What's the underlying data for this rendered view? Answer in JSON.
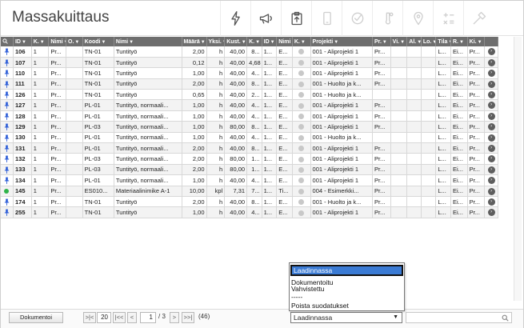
{
  "header": {
    "title": "Massakuittaus",
    "toolbar": [
      {
        "name": "bolt-icon",
        "enabled": true
      },
      {
        "name": "megaphone-icon",
        "enabled": true
      },
      {
        "name": "clipboard-upload-icon",
        "enabled": true
      },
      {
        "name": "phone-icon",
        "enabled": false
      },
      {
        "name": "check-circle-icon",
        "enabled": false
      },
      {
        "name": "thermometer-icon",
        "enabled": false
      },
      {
        "name": "location-pin-icon",
        "enabled": false
      },
      {
        "name": "calculator-icon",
        "enabled": false
      },
      {
        "name": "hammer-icon",
        "enabled": false
      }
    ]
  },
  "table": {
    "columns": [
      "ID",
      "K.",
      "Nimi",
      "O.",
      "Koodi",
      "Nimi",
      "Määrä",
      "Yksi.",
      "Kust.",
      "K.",
      "ID",
      "Nimi",
      "K.",
      "Projekti",
      "Pr.",
      "Vi.",
      "Al.",
      "Lo.",
      "Tila",
      "R.",
      "Ki."
    ],
    "rows": [
      {
        "status": "pin",
        "cells": [
          "106",
          "1",
          "Pr...",
          "",
          "TN-01",
          "Tuntityö",
          "2,00",
          "h",
          "40,00",
          "8...",
          "1...",
          "E...",
          "",
          "001 - Aliprojekti 1",
          "Pr...",
          "",
          "",
          "",
          "L...",
          "Ei...",
          "Pr..."
        ]
      },
      {
        "status": "pin",
        "cells": [
          "107",
          "1",
          "Pr...",
          "",
          "TN-01",
          "Tuntityö",
          "0,12",
          "h",
          "40,00",
          "4,68",
          "1...",
          "E...",
          "",
          "001 - Aliprojekti 1",
          "Pr...",
          "",
          "",
          "",
          "L...",
          "Ei...",
          "Pr..."
        ]
      },
      {
        "status": "pin",
        "cells": [
          "110",
          "1",
          "Pr...",
          "",
          "TN-01",
          "Tuntityö",
          "1,00",
          "h",
          "40,00",
          "4...",
          "1...",
          "E...",
          "",
          "001 - Aliprojekti 1",
          "Pr...",
          "",
          "",
          "",
          "L...",
          "Ei...",
          "Pr..."
        ]
      },
      {
        "status": "pin",
        "cells": [
          "111",
          "1",
          "Pr...",
          "",
          "TN-01",
          "Tuntityö",
          "2,00",
          "h",
          "40,00",
          "8...",
          "1...",
          "E...",
          "",
          "001 - Huolto ja k...",
          "Pr...",
          "",
          "",
          "",
          "L...",
          "Ei...",
          "Pr..."
        ]
      },
      {
        "status": "pin",
        "cells": [
          "126",
          "1",
          "Pr...",
          "",
          "TN-01",
          "Tuntityö",
          "0,65",
          "h",
          "40,00",
          "2...",
          "1...",
          "E...",
          "",
          "001 - Huolto ja k...",
          "",
          "",
          "",
          "",
          "L...",
          "Ei...",
          "Pr..."
        ]
      },
      {
        "status": "pin",
        "cells": [
          "127",
          "1",
          "Pr...",
          "",
          "PL-01",
          "Tuntityö, normaali...",
          "1,00",
          "h",
          "40,00",
          "4...",
          "1...",
          "E...",
          "",
          "001 - Aliprojekti 1",
          "Pr...",
          "",
          "",
          "",
          "L...",
          "Ei...",
          "Pr..."
        ]
      },
      {
        "status": "pin",
        "cells": [
          "128",
          "1",
          "Pr...",
          "",
          "PL-01",
          "Tuntityö, normaali...",
          "1,00",
          "h",
          "40,00",
          "4...",
          "1...",
          "E...",
          "",
          "001 - Aliprojekti 1",
          "Pr...",
          "",
          "",
          "",
          "L...",
          "Ei...",
          "Pr..."
        ]
      },
      {
        "status": "pin",
        "cells": [
          "129",
          "1",
          "Pr...",
          "",
          "PL-03",
          "Tuntityö, normaali...",
          "1,00",
          "h",
          "80,00",
          "8...",
          "1...",
          "E...",
          "",
          "001 - Aliprojekti 1",
          "Pr...",
          "",
          "",
          "",
          "L...",
          "Ei...",
          "Pr..."
        ]
      },
      {
        "status": "pin",
        "cells": [
          "130",
          "1",
          "Pr...",
          "",
          "PL-01",
          "Tuntityö, normaali...",
          "1,00",
          "h",
          "40,00",
          "4...",
          "1...",
          "E...",
          "",
          "001 - Huolto ja k...",
          "",
          "",
          "",
          "",
          "L...",
          "Ei...",
          "Pr..."
        ]
      },
      {
        "status": "pin",
        "cells": [
          "131",
          "1",
          "Pr...",
          "",
          "PL-01",
          "Tuntityö, normaali...",
          "2,00",
          "h",
          "40,00",
          "8...",
          "1...",
          "E...",
          "",
          "001 - Aliprojekti 1",
          "Pr...",
          "",
          "",
          "",
          "L...",
          "Ei...",
          "Pr..."
        ]
      },
      {
        "status": "pin",
        "cells": [
          "132",
          "1",
          "Pr...",
          "",
          "PL-03",
          "Tuntityö, normaali...",
          "2,00",
          "h",
          "80,00",
          "1...",
          "1...",
          "E...",
          "",
          "001 - Aliprojekti 1",
          "Pr...",
          "",
          "",
          "",
          "L...",
          "Ei...",
          "Pr..."
        ]
      },
      {
        "status": "pin",
        "cells": [
          "133",
          "1",
          "Pr...",
          "",
          "PL-03",
          "Tuntityö, normaali...",
          "2,00",
          "h",
          "80,00",
          "1...",
          "1...",
          "E...",
          "",
          "001 - Aliprojekti 1",
          "Pr...",
          "",
          "",
          "",
          "L...",
          "Ei...",
          "Pr..."
        ]
      },
      {
        "status": "pin",
        "cells": [
          "134",
          "1",
          "Pr...",
          "",
          "PL-01",
          "Tuntityö, normaali...",
          "1,00",
          "h",
          "40,00",
          "4...",
          "1...",
          "E...",
          "",
          "001 - Aliprojekti 1",
          "Pr...",
          "",
          "",
          "",
          "L...",
          "Ei...",
          "Pr..."
        ]
      },
      {
        "status": "green",
        "cells": [
          "145",
          "1",
          "Pr...",
          "",
          "ES010...",
          "Materiaalinimike A-1",
          "10,00",
          "kpl",
          "7,31",
          "7...",
          "1...",
          "Ti...",
          "",
          "004 - Esimerkki...",
          "Pr...",
          "",
          "",
          "",
          "L...",
          "Ei...",
          "Pr..."
        ]
      },
      {
        "status": "pin",
        "cells": [
          "174",
          "1",
          "Pr...",
          "",
          "TN-01",
          "Tuntityö",
          "2,00",
          "h",
          "40,00",
          "8...",
          "1...",
          "E...",
          "",
          "001 - Huolto ja k...",
          "Pr...",
          "",
          "",
          "",
          "L...",
          "Ei...",
          "Pr..."
        ]
      },
      {
        "status": "pin",
        "cells": [
          "255",
          "1",
          "Pr...",
          "",
          "TN-01",
          "Tuntityö",
          "1,00",
          "h",
          "40,00",
          "4...",
          "1...",
          "E...",
          "",
          "001 - Aliprojekti 1",
          "Pr...",
          "",
          "",
          "",
          "L...",
          "Ei...",
          "Pr..."
        ]
      }
    ]
  },
  "footer": {
    "document_button": "Dokumentoi",
    "pager": {
      "first": ">|<",
      "page_size": "20",
      "prev_many": "|<<",
      "prev": "<",
      "current_page": "1",
      "total": "/ 3",
      "next": ">",
      "next_many": ">>|",
      "count": "(46)"
    },
    "filter_select": {
      "value": "Laadinnassa"
    }
  },
  "dropdown": {
    "options": [
      "Laadinnassa",
      "Dokumentoitu",
      "Vahvistettu",
      "-----",
      "Poista suodatukset"
    ],
    "selected_index": 0
  },
  "colors": {
    "header_bg": "#6e6e6e",
    "selection": "#3b7bd4",
    "pin": "#2a5bd7",
    "green": "#2fb34a"
  }
}
